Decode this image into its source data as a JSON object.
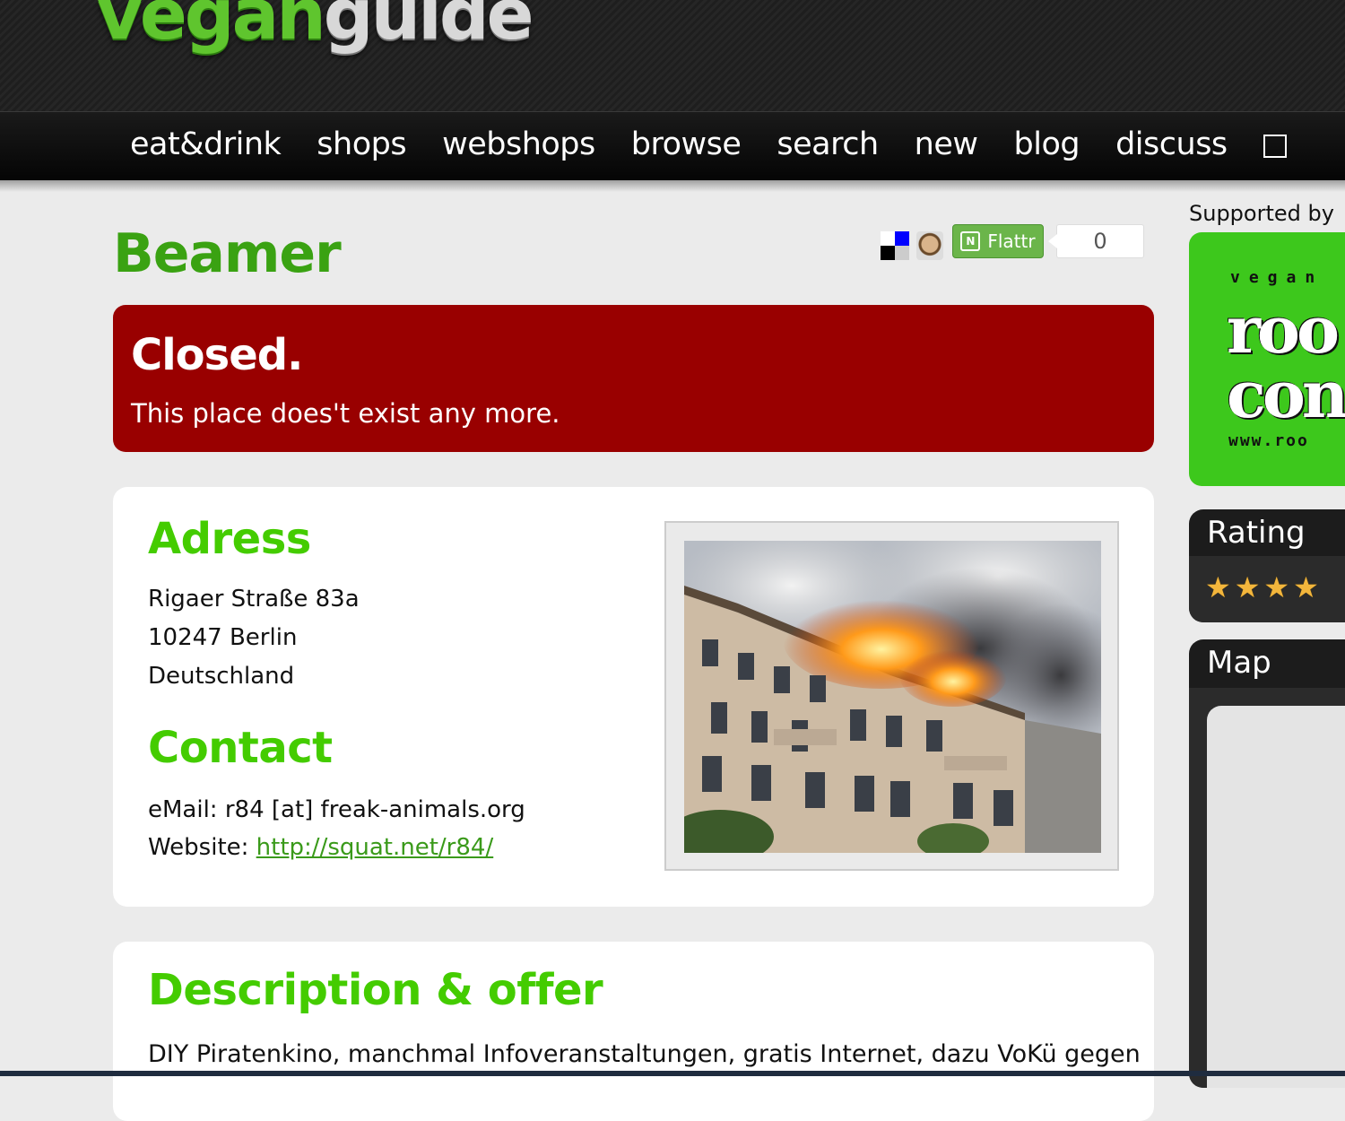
{
  "site": {
    "logo_part1": "vegan",
    "logo_part2": "guide"
  },
  "nav": {
    "items": [
      "eat&drink",
      "shops",
      "webshops",
      "browse",
      "search",
      "new",
      "blog",
      "discuss"
    ]
  },
  "place": {
    "name": "Beamer"
  },
  "share": {
    "flattr_label": "Flattr",
    "flattr_count": "0"
  },
  "closed": {
    "heading": "Closed.",
    "message": "This place does't exist any more."
  },
  "address": {
    "heading": "Adress",
    "street": "Rigaer Straße 83a",
    "city": "10247 Berlin",
    "country": "Deutschland"
  },
  "contact": {
    "heading": "Contact",
    "email_label": "eMail:",
    "email": "r84 [at] freak-animals.org",
    "website_label": "Website:",
    "website": "http://squat.net/r84/"
  },
  "description": {
    "heading": "Description & offer",
    "text": "DIY Piratenkino, manchmal Infoveranstaltungen, gratis Internet, dazu VoKü gegen"
  },
  "sidebar": {
    "supported_by": "Supported by",
    "ad": {
      "line1": "vegan",
      "line2": "roo",
      "line3": "con",
      "url": "www.roo"
    },
    "rating": {
      "heading": "Rating",
      "stars": 4
    },
    "map": {
      "heading": "Map"
    }
  },
  "colors": {
    "brand_green": "#44cc00",
    "title_green": "#3aa212",
    "closed_red": "#990000"
  }
}
